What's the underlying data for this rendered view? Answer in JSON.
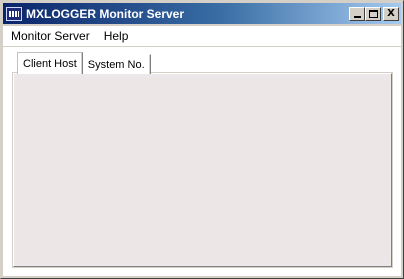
{
  "window": {
    "title": "MXLOGGER Monitor Server",
    "buttons": {
      "minimize": "minimize",
      "maximize": "maximize",
      "close_label": "X"
    }
  },
  "menubar": {
    "items": [
      {
        "label": "Monitor Server"
      },
      {
        "label": "Help"
      }
    ]
  },
  "tabs": [
    {
      "label": "Client Host",
      "active": true
    },
    {
      "label": "System No.",
      "active": false
    }
  ],
  "colors": {
    "titlebar_start": "#0a246a",
    "titlebar_end": "#a6caf0",
    "panel_background": "#ece6e7"
  }
}
